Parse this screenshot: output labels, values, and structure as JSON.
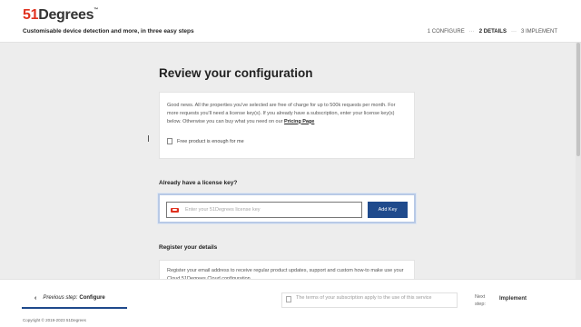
{
  "header": {
    "logo_num": "51",
    "logo_word": "Degrees",
    "logo_tm": "™",
    "tagline": "Customisable device detection and more, in three easy steps",
    "steps": [
      {
        "label": "1 CONFIGURE",
        "active": false
      },
      {
        "label": "2 DETAILS",
        "active": true
      },
      {
        "label": "3 IMPLEMENT",
        "active": false
      }
    ],
    "step_separator": "···"
  },
  "main": {
    "title": "Review your configuration",
    "info_text": "Good news. All the properties you've selected are free of charge for up to 500k requests per month. For more requests you'll need a license key(s). If you already have a subscription, enter your license key(s) below. Otherwise you can buy what you need on our",
    "pricing_link": "Pricing Page",
    "free_checkbox_label": "Free product is enough for me",
    "license_heading": "Already have a license key?",
    "license_placeholder": "Enter your 51Degrees license key",
    "add_key_label": "Add Key",
    "register_heading": "Register your details",
    "register_text": "Register your email address to receive regular product updates, support and custom how-to make use your Cloud 51Degrees Cloud configuration."
  },
  "footer": {
    "prev_prefix": "Previous step:",
    "prev_label": "Configure",
    "terms_text": "The terms of your subscription apply to the use of this service",
    "next_label": "Next step:",
    "implement_label": "Implement",
    "copyright": "Copyright © 2019-2023 51Degrees"
  },
  "colors": {
    "brand_red": "#e0321f",
    "accent_blue": "#1f4a8c"
  }
}
